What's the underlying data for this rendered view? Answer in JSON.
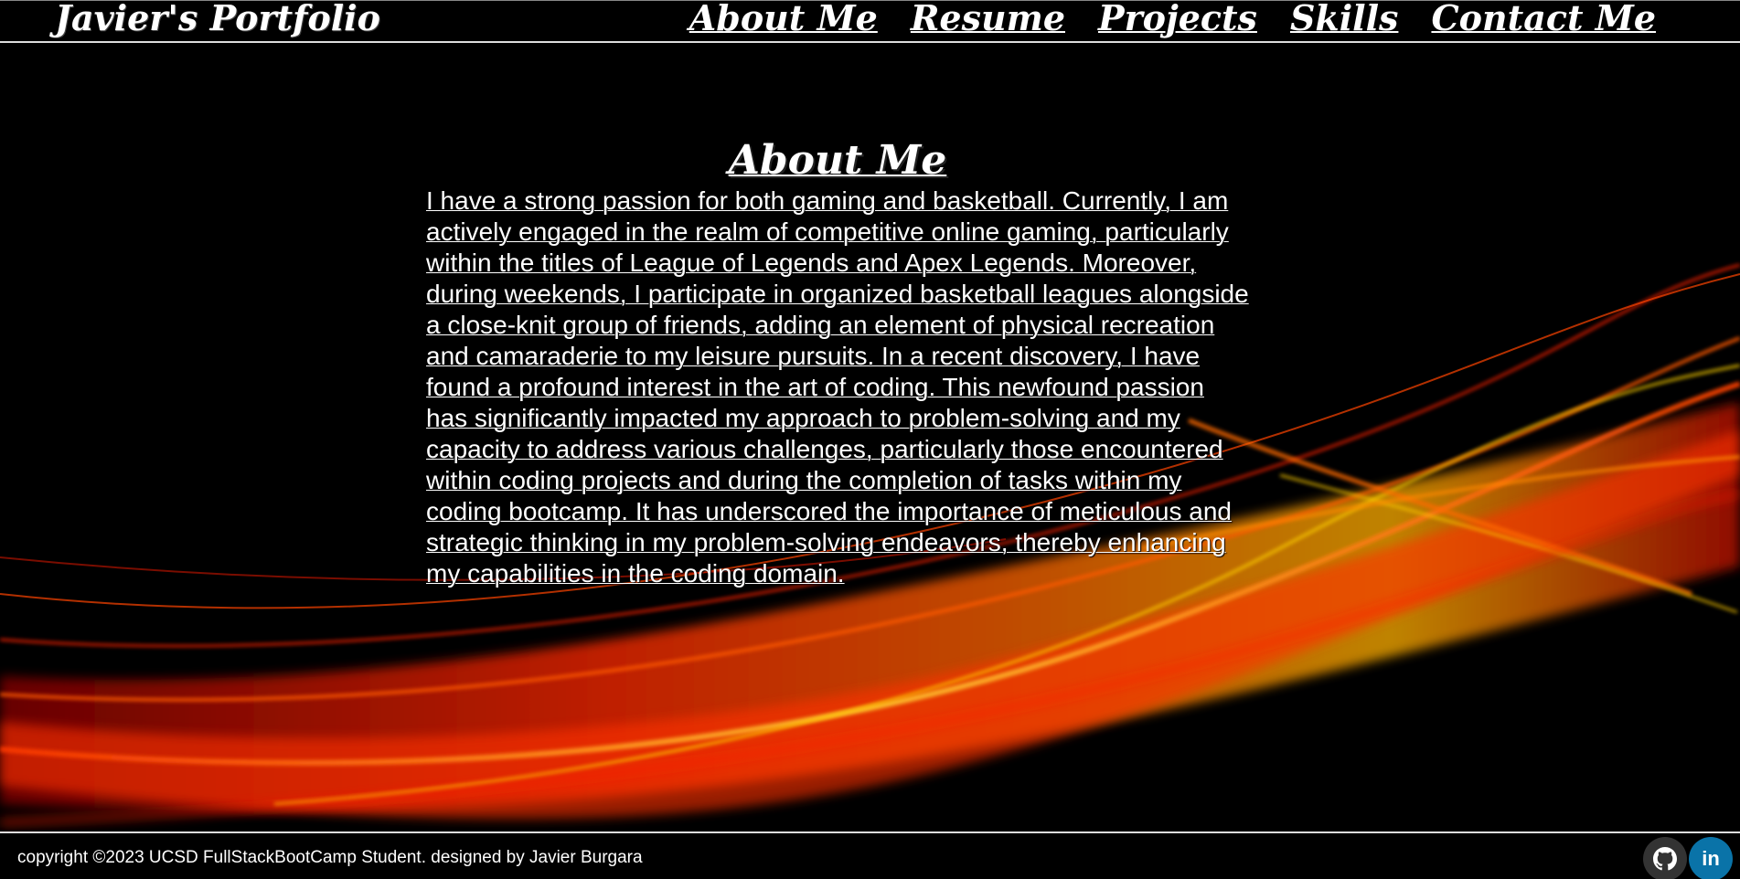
{
  "header": {
    "brand": "Javier's Portfolio",
    "nav": [
      {
        "label": "About Me"
      },
      {
        "label": "Resume"
      },
      {
        "label": "Projects"
      },
      {
        "label": "Skills"
      },
      {
        "label": "Contact Me"
      }
    ]
  },
  "main": {
    "title": "About Me",
    "body": "I have a strong passion for both gaming and basketball. Currently, I am actively engaged in the realm of competitive online gaming, particularly within the titles of League of Legends and Apex Legends. Moreover, during weekends, I participate in organized basketball leagues alongside a close-knit group of friends, adding an element of physical recreation and camaraderie to my leisure pursuits. In a recent discovery, I have found a profound interest in the art of coding. This newfound passion has significantly impacted my approach to problem-solving and my capacity to address various challenges, particularly those encountered within coding projects and during the completion of tasks within my coding bootcamp. It has underscored the importance of meticulous and strategic thinking in my problem-solving endeavors, thereby enhancing my capabilities in the coding domain."
  },
  "footer": {
    "copyright": "copyright ©2023 UCSD FullStackBootCamp Student. designed by Javier Burgara",
    "social": [
      {
        "icon": "github-icon"
      },
      {
        "icon": "linkedin-icon",
        "label": "in"
      }
    ]
  },
  "colors": {
    "background": "#000000",
    "text": "#ffffff",
    "flame_red": "#e01b00",
    "flame_orange": "#ff7a00",
    "flame_yellow": "#ffd200",
    "linkedin": "#0a73a8",
    "github": "#333333"
  }
}
